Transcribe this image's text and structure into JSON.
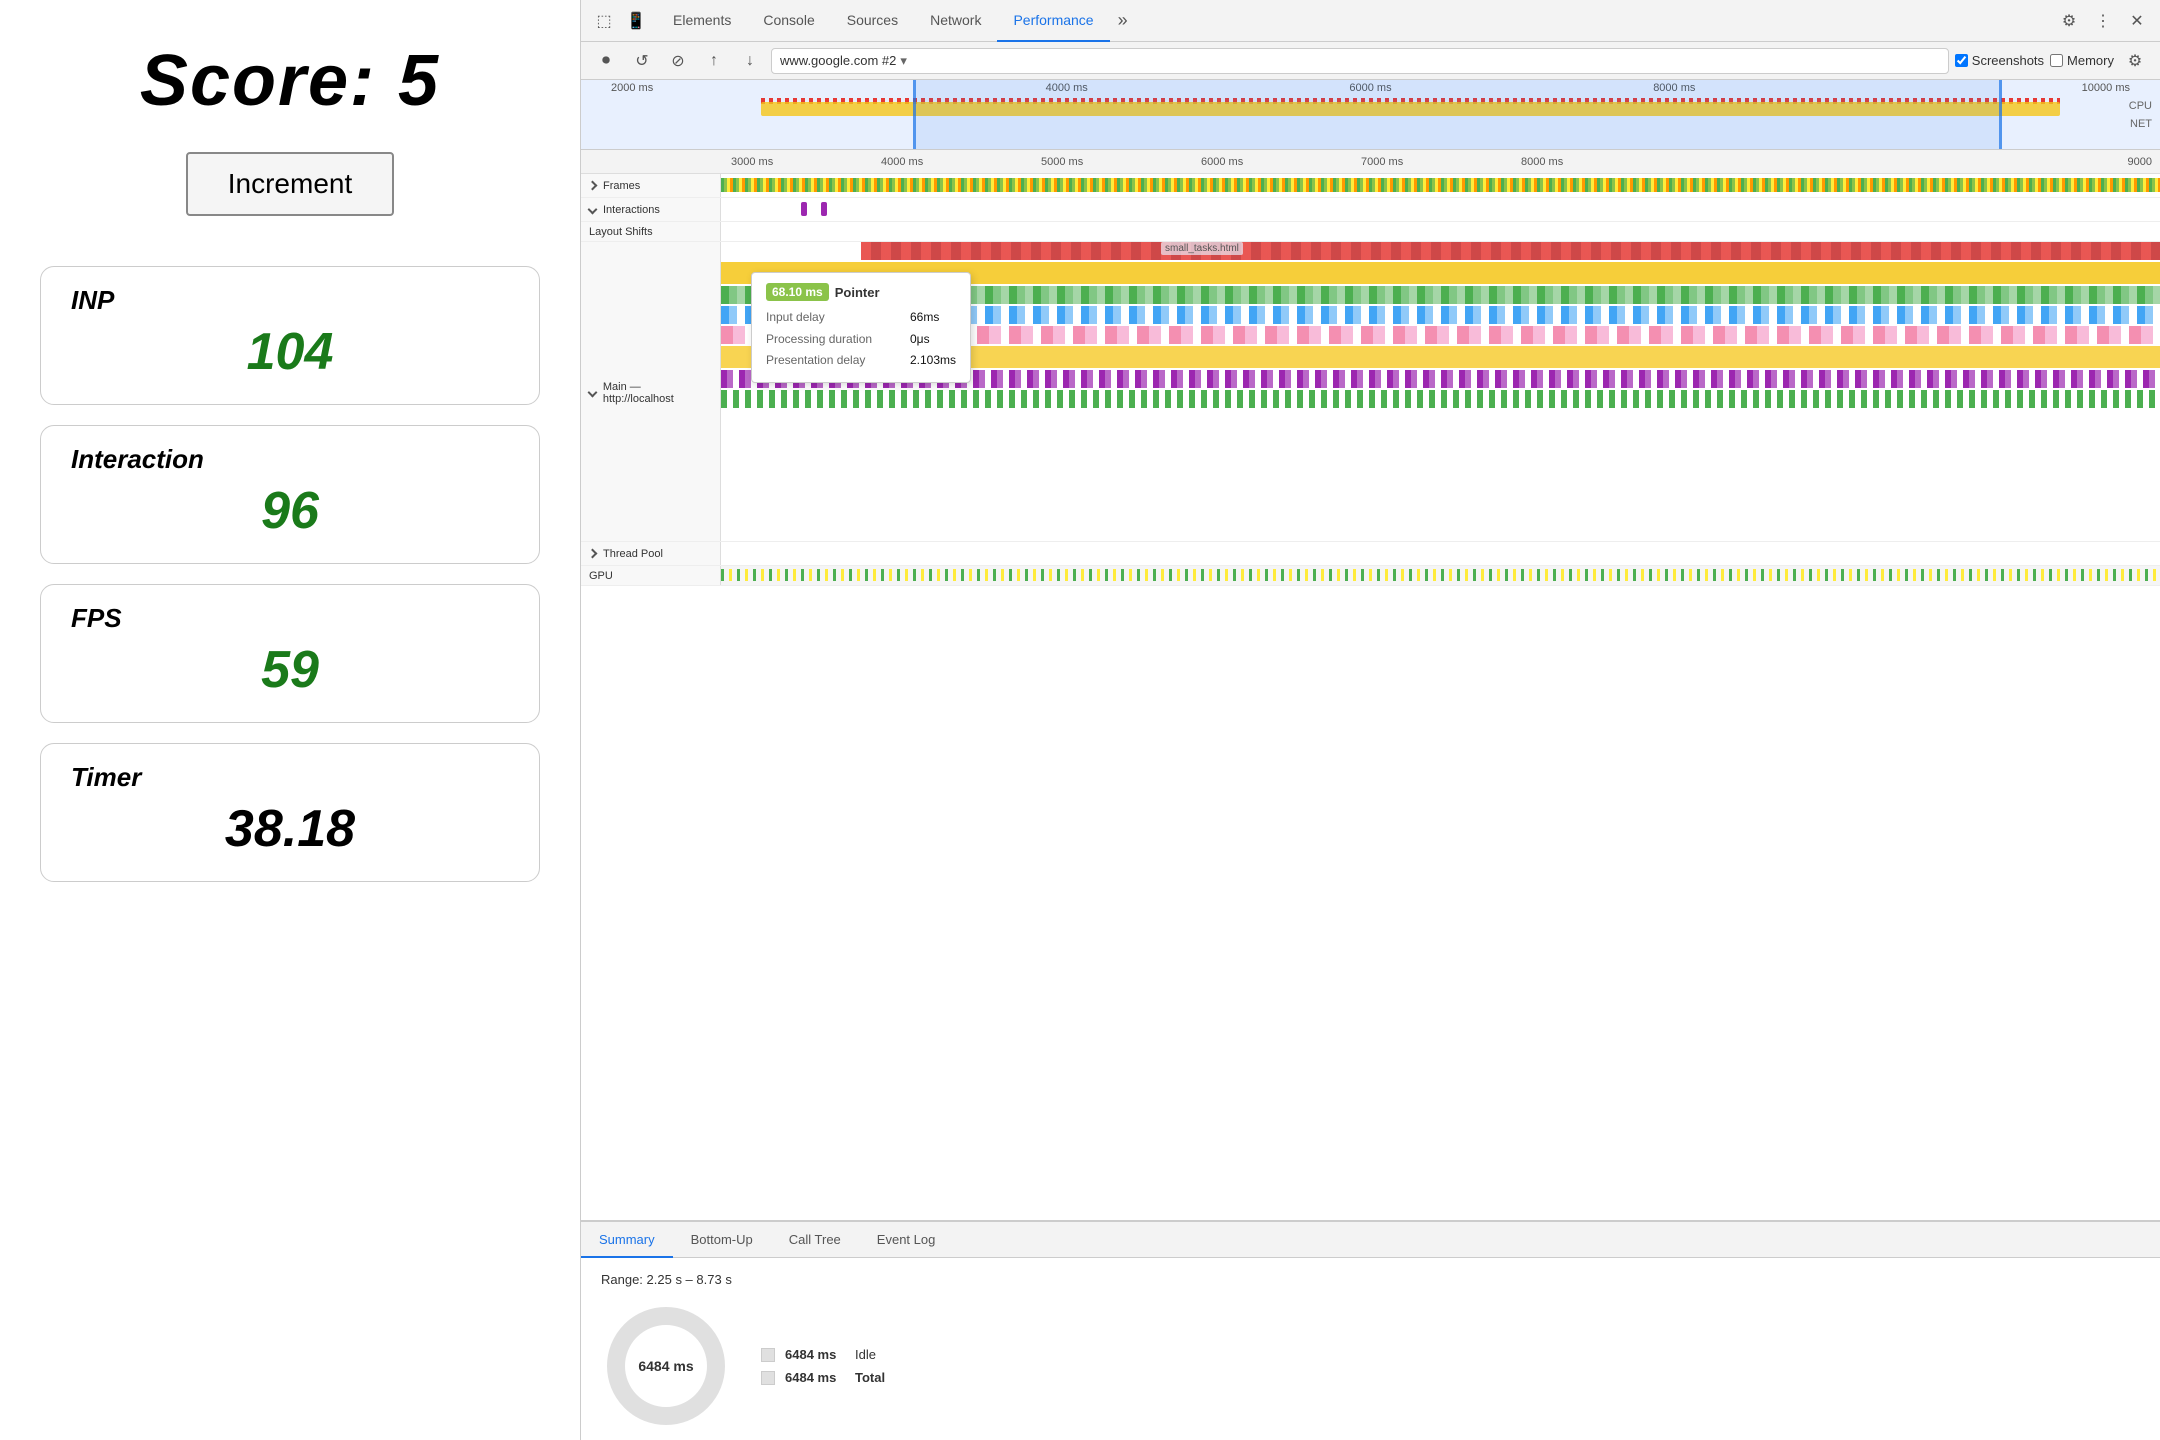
{
  "left": {
    "score_label": "Score:",
    "score_value": "5",
    "increment_label": "Increment",
    "metrics": [
      {
        "label": "INP",
        "value": "104",
        "style": "green"
      },
      {
        "label": "Interaction",
        "value": "96",
        "style": "green"
      },
      {
        "label": "FPS",
        "value": "59",
        "style": "green"
      },
      {
        "label": "Timer",
        "value": "38.18",
        "style": "black"
      }
    ]
  },
  "devtools": {
    "tabs": [
      "Elements",
      "Console",
      "Sources",
      "Network",
      "Performance"
    ],
    "active_tab": "Performance",
    "toolbar2": {
      "url": "www.google.com #2",
      "screenshots_checked": true,
      "memory_checked": false
    },
    "timeline": {
      "ruler_ticks": [
        "2000 ms",
        "4000 ms",
        "6000 ms",
        "8000 ms",
        "10000 ms"
      ],
      "ruler2_ticks": [
        "3000 ms",
        "4000 ms",
        "5000 ms",
        "6000 ms",
        "7000 ms",
        "8000 ms",
        "9000"
      ],
      "sections": {
        "frames": "Frames",
        "interactions": "Interactions",
        "layout_shifts": "Layout Shifts",
        "main": "Main — http://localhost",
        "thread_pool": "Thread Pool",
        "gpu": "GPU"
      }
    },
    "tooltip": {
      "ms": "68.10 ms",
      "type": "Pointer",
      "input_delay_label": "Input delay",
      "input_delay_val": "66ms",
      "processing_label": "Processing duration",
      "processing_val": "0μs",
      "presentation_label": "Presentation delay",
      "presentation_val": "2.103ms",
      "small_tasks": "small_tasks.html"
    },
    "bottom": {
      "tabs": [
        "Summary",
        "Bottom-Up",
        "Call Tree",
        "Event Log"
      ],
      "active_tab": "Summary",
      "range": "Range: 2.25 s – 8.73 s",
      "donut_center": "6484 ms",
      "legend": [
        {
          "ms": "6484 ms",
          "label": "Idle"
        },
        {
          "ms": "6484 ms",
          "label": "Total",
          "bold": true
        }
      ]
    }
  },
  "icons": {
    "record": "⏺",
    "reload": "↺",
    "clear": "⊘",
    "upload": "↑",
    "download": "↓",
    "gear": "⚙",
    "dots": "⋮",
    "close": "✕",
    "more": "»",
    "cursor": "⬚",
    "inspect": "⬚",
    "settings_small": "⚙",
    "dropdown_arrow": "▾"
  }
}
